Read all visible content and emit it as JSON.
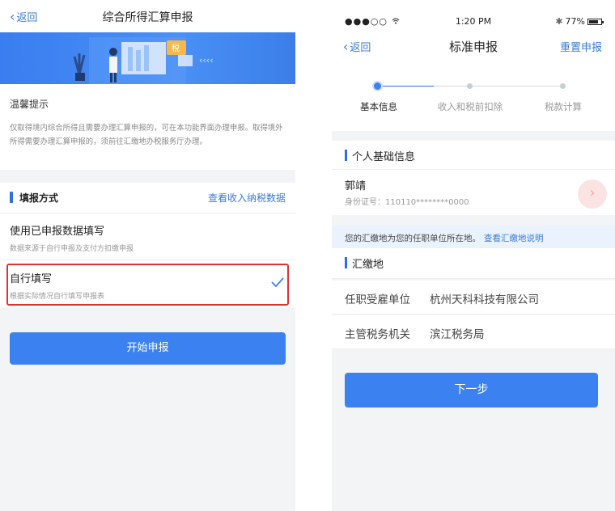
{
  "left": {
    "nav": {
      "back": "返回",
      "title": "综合所得汇算申报"
    },
    "banner": {
      "arrows": "‹‹‹‹",
      "tag": "税"
    },
    "tip": {
      "title": "温馨提示",
      "text": "仅取得境内综合所得且需要办理汇算申报的，可在本功能界面办理申报。取得境外所得需要办理汇算申报的，须前往汇缴地办税服务厅办理。"
    },
    "fill_method": {
      "label": "填报方式",
      "link": "查看收入纳税数据"
    },
    "options": [
      {
        "title": "使用已申报数据填写",
        "sub": "数据来源于自行申报及支付方扣缴申报"
      },
      {
        "title": "自行填写",
        "sub": "根据实际情况自行填写申报表"
      }
    ],
    "start_button": "开始申报",
    "colors": {
      "accent": "#3b82f0",
      "highlight": "#e03232"
    }
  },
  "right": {
    "status": {
      "signal": "●●●○○ ",
      "wifi": "wifi-icon",
      "time": "1:20 PM",
      "bt": "✱",
      "battery_pct": "77%"
    },
    "nav": {
      "back": "返回",
      "title": "标准申报",
      "reset": "重置申报"
    },
    "steps": [
      "基本信息",
      "收入和税前扣除",
      "税款计算"
    ],
    "personal": {
      "section": "个人基础信息",
      "name": "郭靖",
      "id": "身份证号：110110********0000"
    },
    "notice": {
      "text": "您的汇缴地为您的任职单位所在地。",
      "link": "查看汇缴地说明"
    },
    "payment_place": {
      "section": "汇缴地",
      "employer_label": "任职受雇单位",
      "employer_value": "杭州天科科技有限公司",
      "tax_office_label": "主管税务机关",
      "tax_office_value": "滨江税务局"
    },
    "next_button": "下一步"
  }
}
